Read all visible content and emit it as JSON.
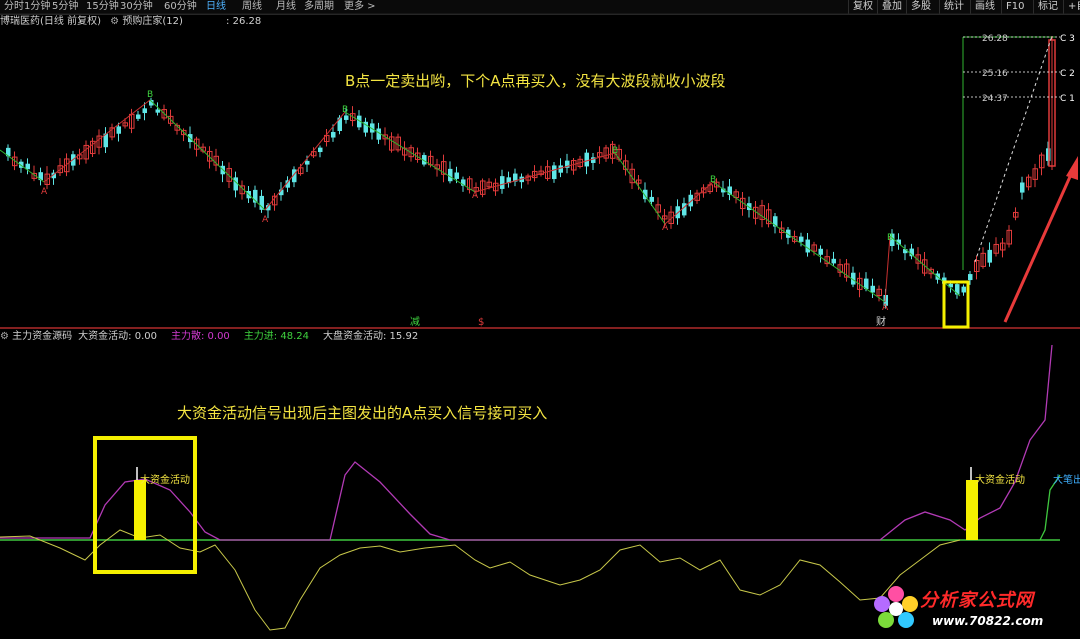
{
  "toolbar": {
    "timeframes": [
      "分时",
      "1分钟",
      "5分钟",
      "15分钟",
      "30分钟",
      "60分钟",
      "日线",
      "周线",
      "月线",
      "多周期",
      "更多 >"
    ],
    "active_timeframe": "日线",
    "right_buttons": [
      "复权",
      "叠加",
      "多股",
      "统计",
      "画线",
      "F10",
      "标记",
      "+自"
    ]
  },
  "stock_info": {
    "name": "博瑞医药(日线 前复权)",
    "indicator": "预购庄家(12)",
    "value": ": 26.28"
  },
  "annotations": {
    "main_note": "B点一定卖出哟，下个A点再买入，没有大波段就收小波段",
    "indicator_note": "大资金活动信号出现后主图发出的A点买入信号接可买入"
  },
  "main_chart": {
    "price_labels": [
      {
        "text": "26.28",
        "tag": "C 3"
      },
      {
        "text": "25.16",
        "tag": "C 2"
      },
      {
        "text": "24.37",
        "tag": "C 1"
      }
    ],
    "bottom_markers": [
      "减",
      "$",
      "财"
    ],
    "signal_letters": {
      "buy": "A",
      "sell": "B"
    }
  },
  "indicator_panel": {
    "title": "主力资金源码",
    "stats": [
      {
        "label": "大资金活动:",
        "value": "0.00",
        "color": "#cfcfcf"
      },
      {
        "label": "主力散:",
        "value": "0.00",
        "color": "#d03ad0"
      },
      {
        "label": "主力进:",
        "value": "48.24",
        "color": "#3fd23f"
      },
      {
        "label": "大盘资金活动:",
        "value": "15.92",
        "color": "#cfcfcf"
      }
    ],
    "signal_labels": [
      "大资金活动",
      "大资金活动",
      "大笔出"
    ]
  },
  "watermark": {
    "site_name": "分析家公式网",
    "url": "www.70822.com"
  },
  "colors": {
    "up_candle": "#e03b3b",
    "down_candle": "#5fe6e6",
    "highlight_box": "#f5f000",
    "purple_line": "#b23ab5",
    "yellow_line": "#c8c84a",
    "green_line": "#3fc83f",
    "arrow": "#e83a3a"
  },
  "chart_data": {
    "type": "candlestick",
    "ticker_text": "博瑞医药(日线 前复权)",
    "levels": [
      26.28,
      25.16,
      24.37
    ],
    "signals": [
      {
        "label": "A",
        "type": "buy",
        "index": 4
      },
      {
        "label": "B",
        "type": "sell",
        "index": 17
      },
      {
        "label": "A",
        "type": "buy",
        "index": 29
      },
      {
        "label": "B",
        "type": "sell",
        "index": 45
      },
      {
        "label": "A",
        "type": "buy",
        "index": 62
      },
      {
        "label": "B",
        "type": "sell",
        "index": 82
      },
      {
        "label": "A",
        "type": "buy",
        "index": 99
      },
      {
        "label": "A",
        "type": "buy",
        "index": 112
      },
      {
        "label": "B",
        "type": "sell",
        "index": 117
      },
      {
        "label": "A",
        "type": "buy",
        "index": 136
      },
      {
        "label": "B",
        "type": "sell",
        "index": 147
      },
      {
        "label": "A",
        "type": "buy",
        "index": 160
      }
    ]
  }
}
